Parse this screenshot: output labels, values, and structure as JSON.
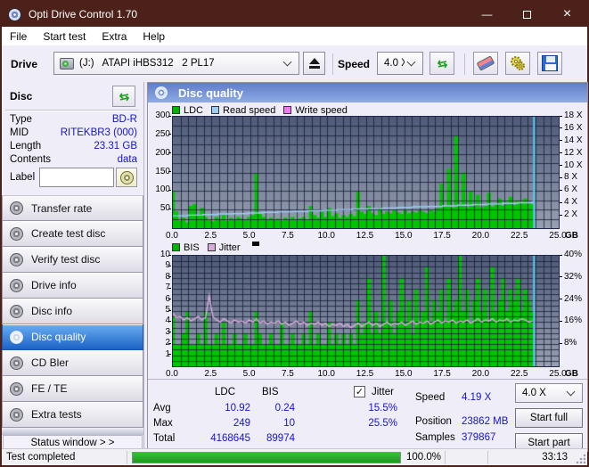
{
  "window": {
    "title": "Opti Drive Control 1.70"
  },
  "icons": {
    "minimize_glyph": "—",
    "close_glyph": "×",
    "refresh_glyph": "⇆",
    "check_glyph": "✓"
  },
  "menu": {
    "items": [
      "File",
      "Start test",
      "Extra",
      "Help"
    ]
  },
  "toolbar": {
    "drive_label": "Drive",
    "drive_value": "(J:)   ATAPI iHBS312   2 PL17",
    "speed_label": "Speed",
    "speed_value": "4.0 X"
  },
  "disc_panel": {
    "title": "Disc",
    "fields": [
      {
        "label": "Type",
        "value": "BD-R"
      },
      {
        "label": "MID",
        "value": "RITEKBR3 (000)"
      },
      {
        "label": "Length",
        "value": "23.31 GB"
      },
      {
        "label": "Contents",
        "value": "data"
      }
    ],
    "label_field": {
      "label": "Label",
      "value": ""
    }
  },
  "sidebar": {
    "items": [
      {
        "label": "Transfer rate",
        "active": false
      },
      {
        "label": "Create test disc",
        "active": false
      },
      {
        "label": "Verify test disc",
        "active": false
      },
      {
        "label": "Drive info",
        "active": false
      },
      {
        "label": "Disc info",
        "active": false
      },
      {
        "label": "Disc quality",
        "active": true
      },
      {
        "label": "CD Bler",
        "active": false
      },
      {
        "label": "FE / TE",
        "active": false
      },
      {
        "label": "Extra tests",
        "active": false
      }
    ],
    "status_window_label": "Status window > >"
  },
  "chart_header": {
    "title": "Disc quality"
  },
  "colors": {
    "ldc_green": "#00c400",
    "read_blue": "#9ccdf2",
    "write_magenta": "#f478f4",
    "jitter_plum": "#d9abdc",
    "end_line_cyan": "#55ccf5",
    "value_blue": "#1414cc"
  },
  "chart_data": [
    {
      "type": "bar",
      "title": "LDC / Read speed / Write speed vs position",
      "x_unit": "GB",
      "x_range": [
        0,
        25
      ],
      "x_ticks": [
        0,
        2.5,
        5,
        7.5,
        10,
        12.5,
        15,
        17.5,
        20,
        22.5,
        25
      ],
      "y_left": {
        "range": [
          0,
          300
        ],
        "ticks": [
          50,
          100,
          150,
          200,
          250,
          300
        ],
        "grid_step": 25
      },
      "y_right": {
        "range": [
          0,
          18
        ],
        "ticks": [
          2,
          4,
          6,
          8,
          10,
          12,
          14,
          16,
          18
        ],
        "suffix": " X"
      },
      "legend": [
        {
          "label": "LDC",
          "color": "#00b400"
        },
        {
          "label": "Read speed",
          "color": "#9ccdf2"
        },
        {
          "label": "Write speed",
          "color": "#f478f4"
        }
      ],
      "series": [
        {
          "name": "LDC",
          "type": "bar",
          "axis": "left",
          "color": "#00c400",
          "x_end": 23.3,
          "values": [
            100,
            45,
            20,
            28,
            15,
            60,
            65,
            35,
            55,
            30,
            22,
            18,
            30,
            25,
            35,
            20,
            28,
            22,
            30,
            26,
            24,
            30,
            35,
            148,
            40,
            30,
            24,
            28,
            22,
            26,
            20,
            28,
            24,
            30,
            22,
            26,
            30,
            24,
            60,
            35,
            28,
            45,
            30,
            55,
            32,
            40,
            28,
            35,
            30,
            38,
            32,
            100,
            45,
            38,
            60,
            40,
            35,
            55,
            38,
            45,
            40,
            50,
            42,
            38,
            48,
            40,
            45,
            42,
            50,
            44,
            40,
            48,
            45,
            55,
            120,
            60,
            160,
            55,
            249,
            65,
            150,
            55,
            100,
            60,
            90,
            55,
            60,
            95,
            58,
            65,
            80,
            60,
            70,
            85,
            62,
            75,
            68,
            80,
            70,
            65
          ]
        },
        {
          "name": "Read speed",
          "type": "line",
          "axis": "right",
          "color": "#9ccdf2",
          "x_end": 23.3,
          "stepped": true,
          "values": [
            2.0,
            2.1,
            2.2,
            2.3,
            2.35,
            2.45,
            2.55,
            2.65,
            2.7,
            2.8,
            2.9,
            3.0,
            3.1,
            3.15,
            3.25,
            3.35,
            3.45,
            3.5,
            3.6,
            3.7,
            3.8,
            3.9,
            4.0,
            4.1,
            4.35
          ]
        },
        {
          "name": "end-marker",
          "type": "vline",
          "color": "#55ccf5",
          "x": 23.4
        }
      ]
    },
    {
      "type": "bar",
      "title": "BIS / Jitter vs position",
      "x_unit": "GB",
      "x_range": [
        0,
        25
      ],
      "x_ticks": [
        0,
        2.5,
        5,
        7.5,
        10,
        12.5,
        15,
        17.5,
        20,
        22.5,
        25
      ],
      "y_left": {
        "range": [
          0,
          10
        ],
        "ticks": [
          1,
          2,
          3,
          4,
          5,
          6,
          7,
          8,
          9,
          10
        ],
        "grid_step": 0.5
      },
      "y_right": {
        "range": [
          0,
          40
        ],
        "ticks": [
          8,
          16,
          24,
          32,
          40
        ],
        "suffix": "%"
      },
      "legend": [
        {
          "label": "BIS",
          "color": "#00b400"
        },
        {
          "label": "Jitter",
          "color": "#d9abdc"
        }
      ],
      "series": [
        {
          "name": "BIS",
          "type": "bar",
          "axis": "left",
          "color": "#00c400",
          "x_end": 23.3,
          "values": [
            4.5,
            2,
            2,
            3,
            5,
            2,
            2,
            3,
            2,
            5,
            2,
            2,
            3,
            2,
            4,
            2,
            2,
            3,
            2,
            2,
            3,
            2,
            2,
            5,
            3,
            2,
            2,
            3,
            2,
            2,
            4,
            2,
            2,
            3,
            2,
            2,
            3,
            2,
            5,
            2,
            3,
            2,
            2,
            4,
            2,
            3,
            2,
            3,
            2,
            3,
            2,
            6,
            3,
            4,
            8,
            3,
            5,
            3,
            10,
            4,
            6,
            3,
            5,
            8,
            4,
            6,
            3,
            7,
            4,
            5,
            9,
            4,
            6,
            5,
            7,
            4,
            8,
            5,
            6,
            10,
            5,
            7,
            4,
            6,
            8,
            5,
            7,
            4,
            9,
            5,
            6,
            8,
            5,
            7,
            6,
            8,
            5,
            7,
            6,
            5
          ]
        },
        {
          "name": "Jitter",
          "type": "line",
          "axis": "left",
          "color": "#d9abdc",
          "x_end": 23.3,
          "stepped": false,
          "values": [
            4.8,
            4.4,
            4.5,
            4.2,
            4.4,
            4.1,
            4.3,
            4.5,
            4.2,
            4.4,
            6.4,
            4.5,
            4.2,
            4.0,
            4.3,
            4.1,
            3.9,
            4.2,
            4.0,
            4.1,
            3.9,
            4.2,
            4.0,
            4.3,
            3.9,
            4.1,
            3.8,
            4.0,
            3.9,
            4.1,
            3.8,
            4.0,
            3.7,
            3.9,
            4.1,
            3.8,
            4.0,
            3.7,
            3.9,
            3.8,
            4.0,
            3.7,
            3.9,
            3.6,
            3.8,
            3.7,
            3.9,
            3.6,
            3.8,
            3.5,
            3.7,
            3.9,
            3.6,
            3.8,
            4.0,
            3.7,
            3.9,
            3.6,
            3.8,
            4.0,
            3.7,
            3.9,
            3.8,
            4.0,
            3.7,
            3.9,
            4.1,
            3.8,
            4.0,
            3.9,
            4.1,
            3.8,
            4.0,
            4.2,
            3.9,
            4.1,
            4.0,
            4.2,
            3.9,
            4.1,
            4.0,
            4.2,
            3.9,
            4.1,
            4.3,
            4.0,
            4.2,
            4.1,
            4.3,
            4.0,
            4.2,
            4.1,
            4.3,
            4.0,
            4.2,
            4.1,
            4.3,
            4.2,
            4.0,
            4.1
          ]
        },
        {
          "name": "end-marker",
          "type": "vline",
          "color": "#55ccf5",
          "x": 23.4
        }
      ]
    }
  ],
  "stats": {
    "col_headers": {
      "ldc": "LDC",
      "bis": "BIS"
    },
    "jitter_label": "Jitter",
    "jitter_checked": true,
    "rows": [
      {
        "label": "Avg",
        "ldc": "10.92",
        "bis": "0.24",
        "jitter": "15.5%"
      },
      {
        "label": "Max",
        "ldc": "249",
        "bis": "10",
        "jitter": "25.5%"
      },
      {
        "label": "Total",
        "ldc": "4168645",
        "bis": "89974",
        "jitter": ""
      }
    ],
    "speed_label": "Speed",
    "speed_value": "4.19 X",
    "position_label": "Position",
    "position_value": "23862 MB",
    "samples_label": "Samples",
    "samples_value": "379867",
    "speed_select_value": "4.0 X",
    "start_full_label": "Start full",
    "start_part_label": "Start part"
  },
  "statusbar": {
    "status": "Test completed",
    "progress_value": 100,
    "progress_pct": "100.0%",
    "time": "33:13"
  }
}
